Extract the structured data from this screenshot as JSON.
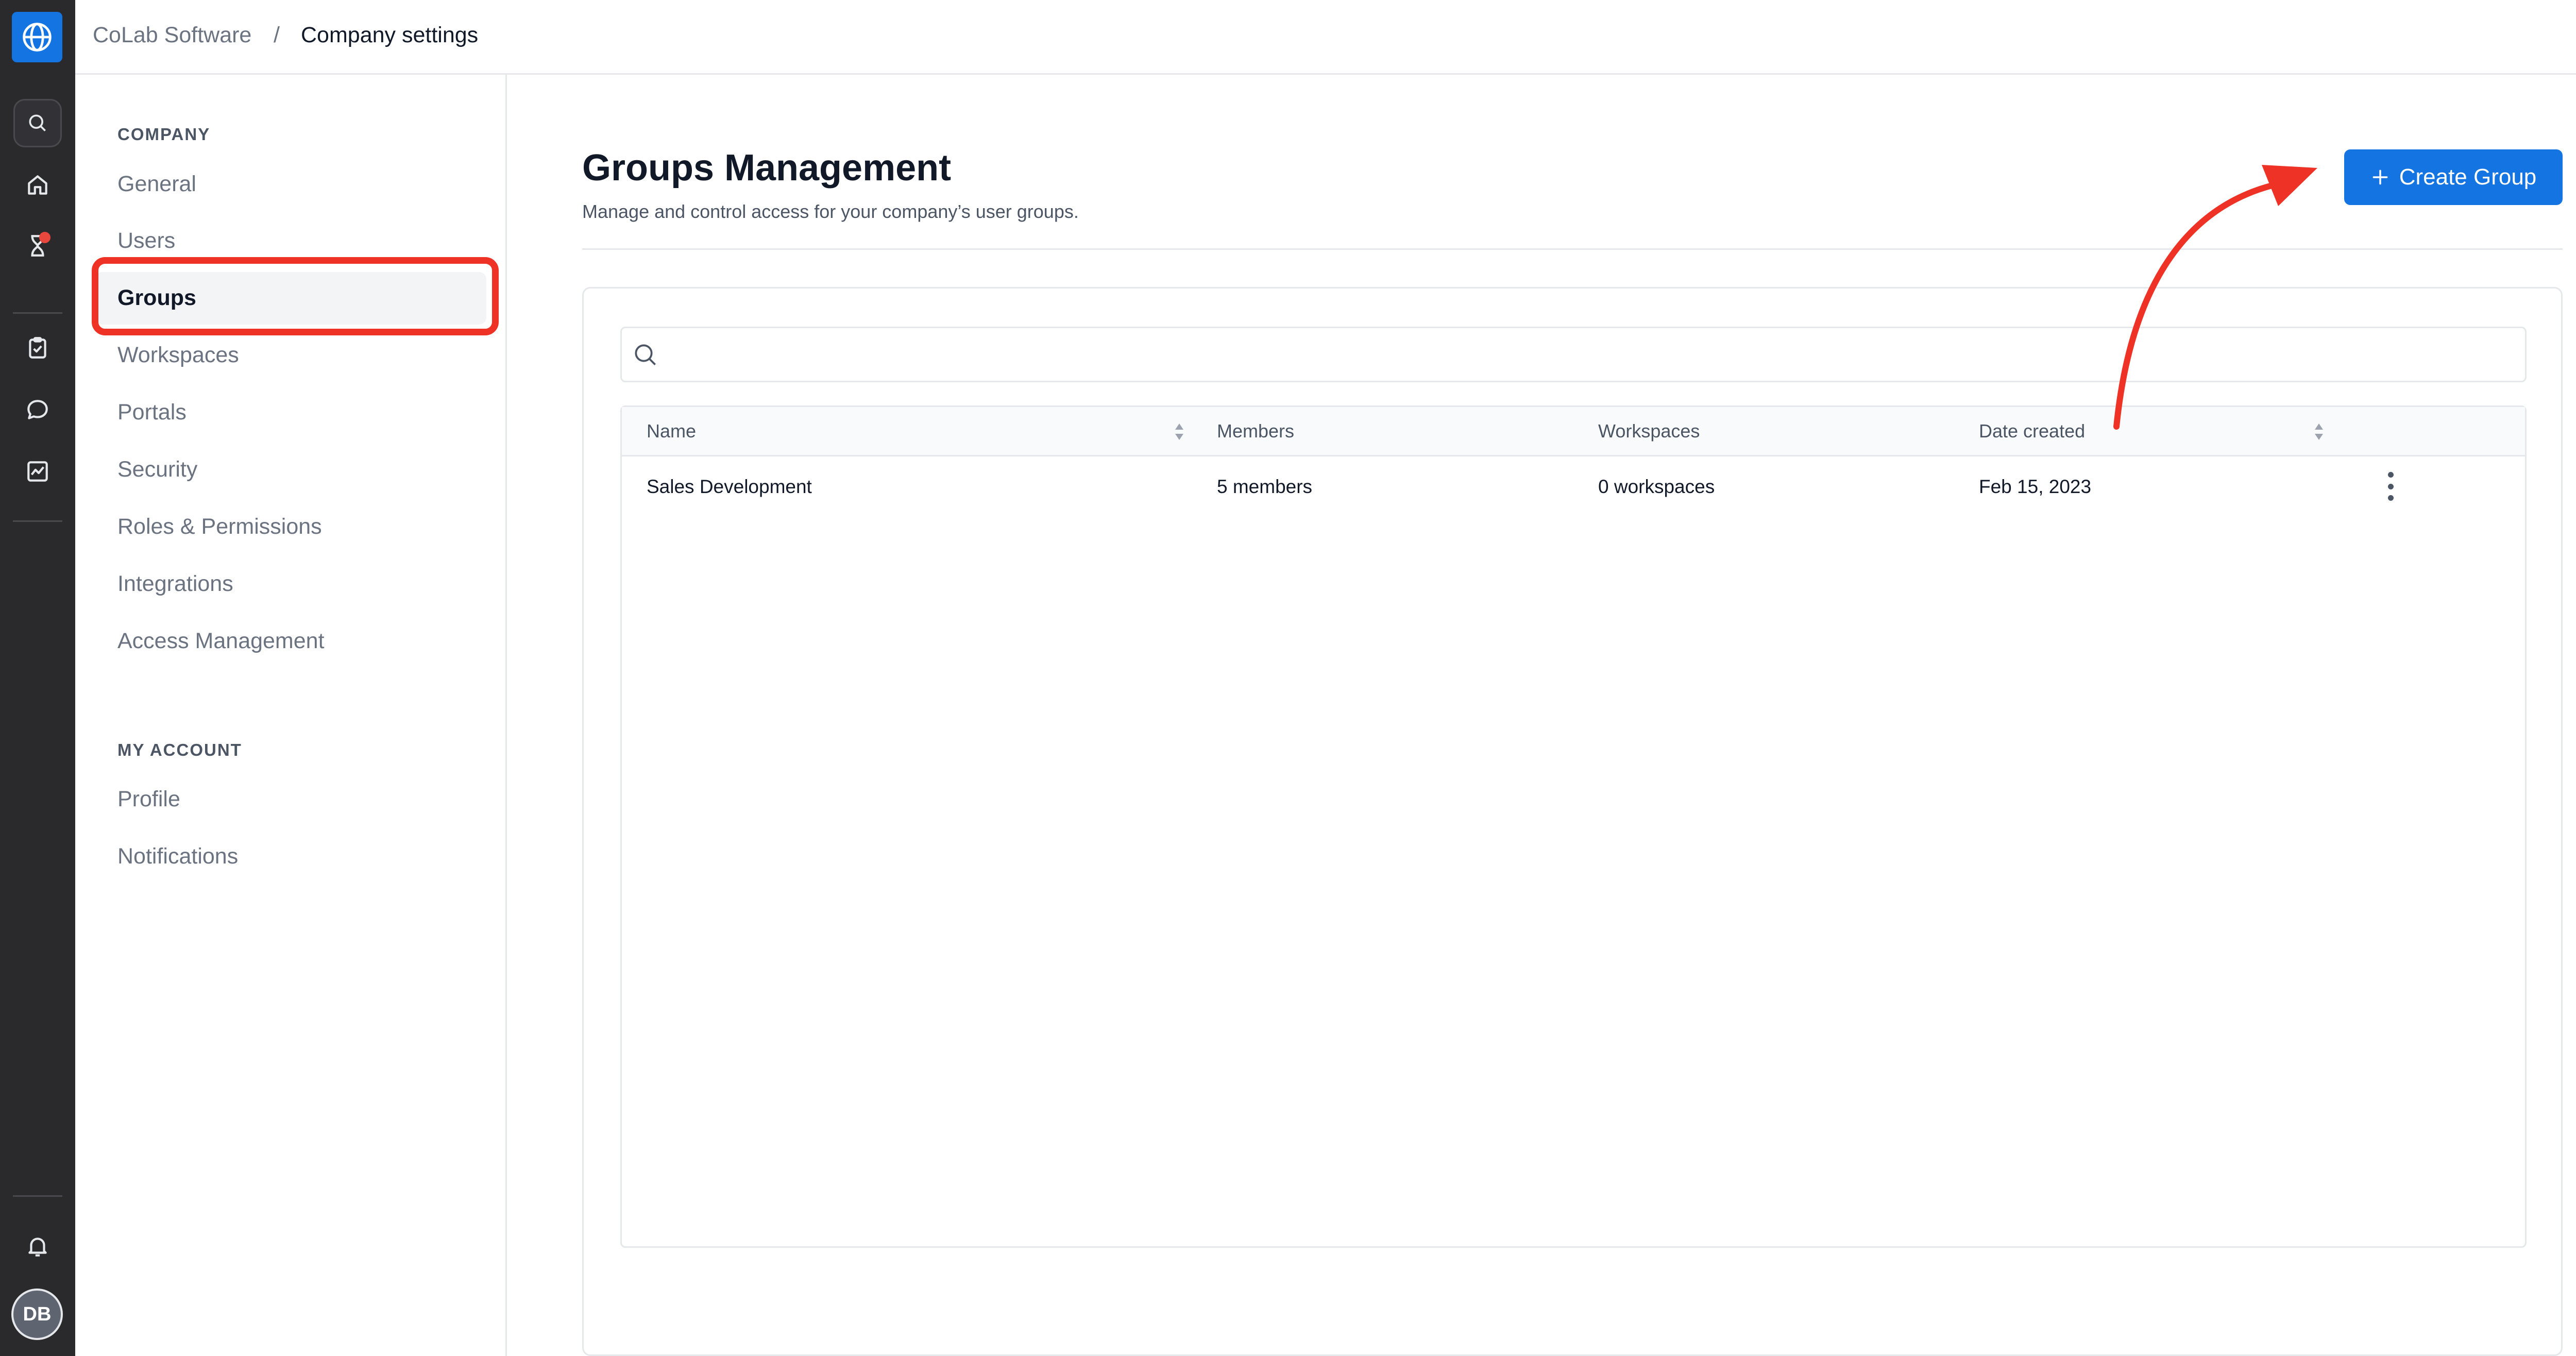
{
  "breadcrumb": {
    "root": "CoLab Software",
    "separator": "/",
    "current": "Company settings"
  },
  "rail": {
    "icons": [
      "globe-icon",
      "search-icon",
      "home-icon",
      "hourglass-icon",
      "clipboard-check-icon",
      "chat-bubble-icon",
      "chart-icon",
      "bell-icon"
    ],
    "avatar_initials": "DB",
    "accent_color": "#1474e1",
    "notification_dot_color": "#e8473e"
  },
  "settings_nav": {
    "company_section": "COMPANY",
    "company_items": [
      "General",
      "Users",
      "Groups",
      "Workspaces",
      "Portals",
      "Security",
      "Roles & Permissions",
      "Integrations",
      "Access Management"
    ],
    "active_item": "Groups",
    "account_section": "MY ACCOUNT",
    "account_items": [
      "Profile",
      "Notifications"
    ]
  },
  "main": {
    "title": "Groups Management",
    "subtitle": "Manage and control access for your company’s user groups.",
    "create_button": "Create Group",
    "search": {
      "value": "",
      "placeholder": ""
    },
    "table": {
      "columns": [
        "Name",
        "Members",
        "Workspaces",
        "Date created"
      ],
      "rows": [
        {
          "name": "Sales Development",
          "members": "5 members",
          "workspaces": "0 workspaces",
          "date_created": "Feb 15, 2023"
        }
      ]
    }
  },
  "annotations": {
    "highlight_color": "#ee3226"
  }
}
